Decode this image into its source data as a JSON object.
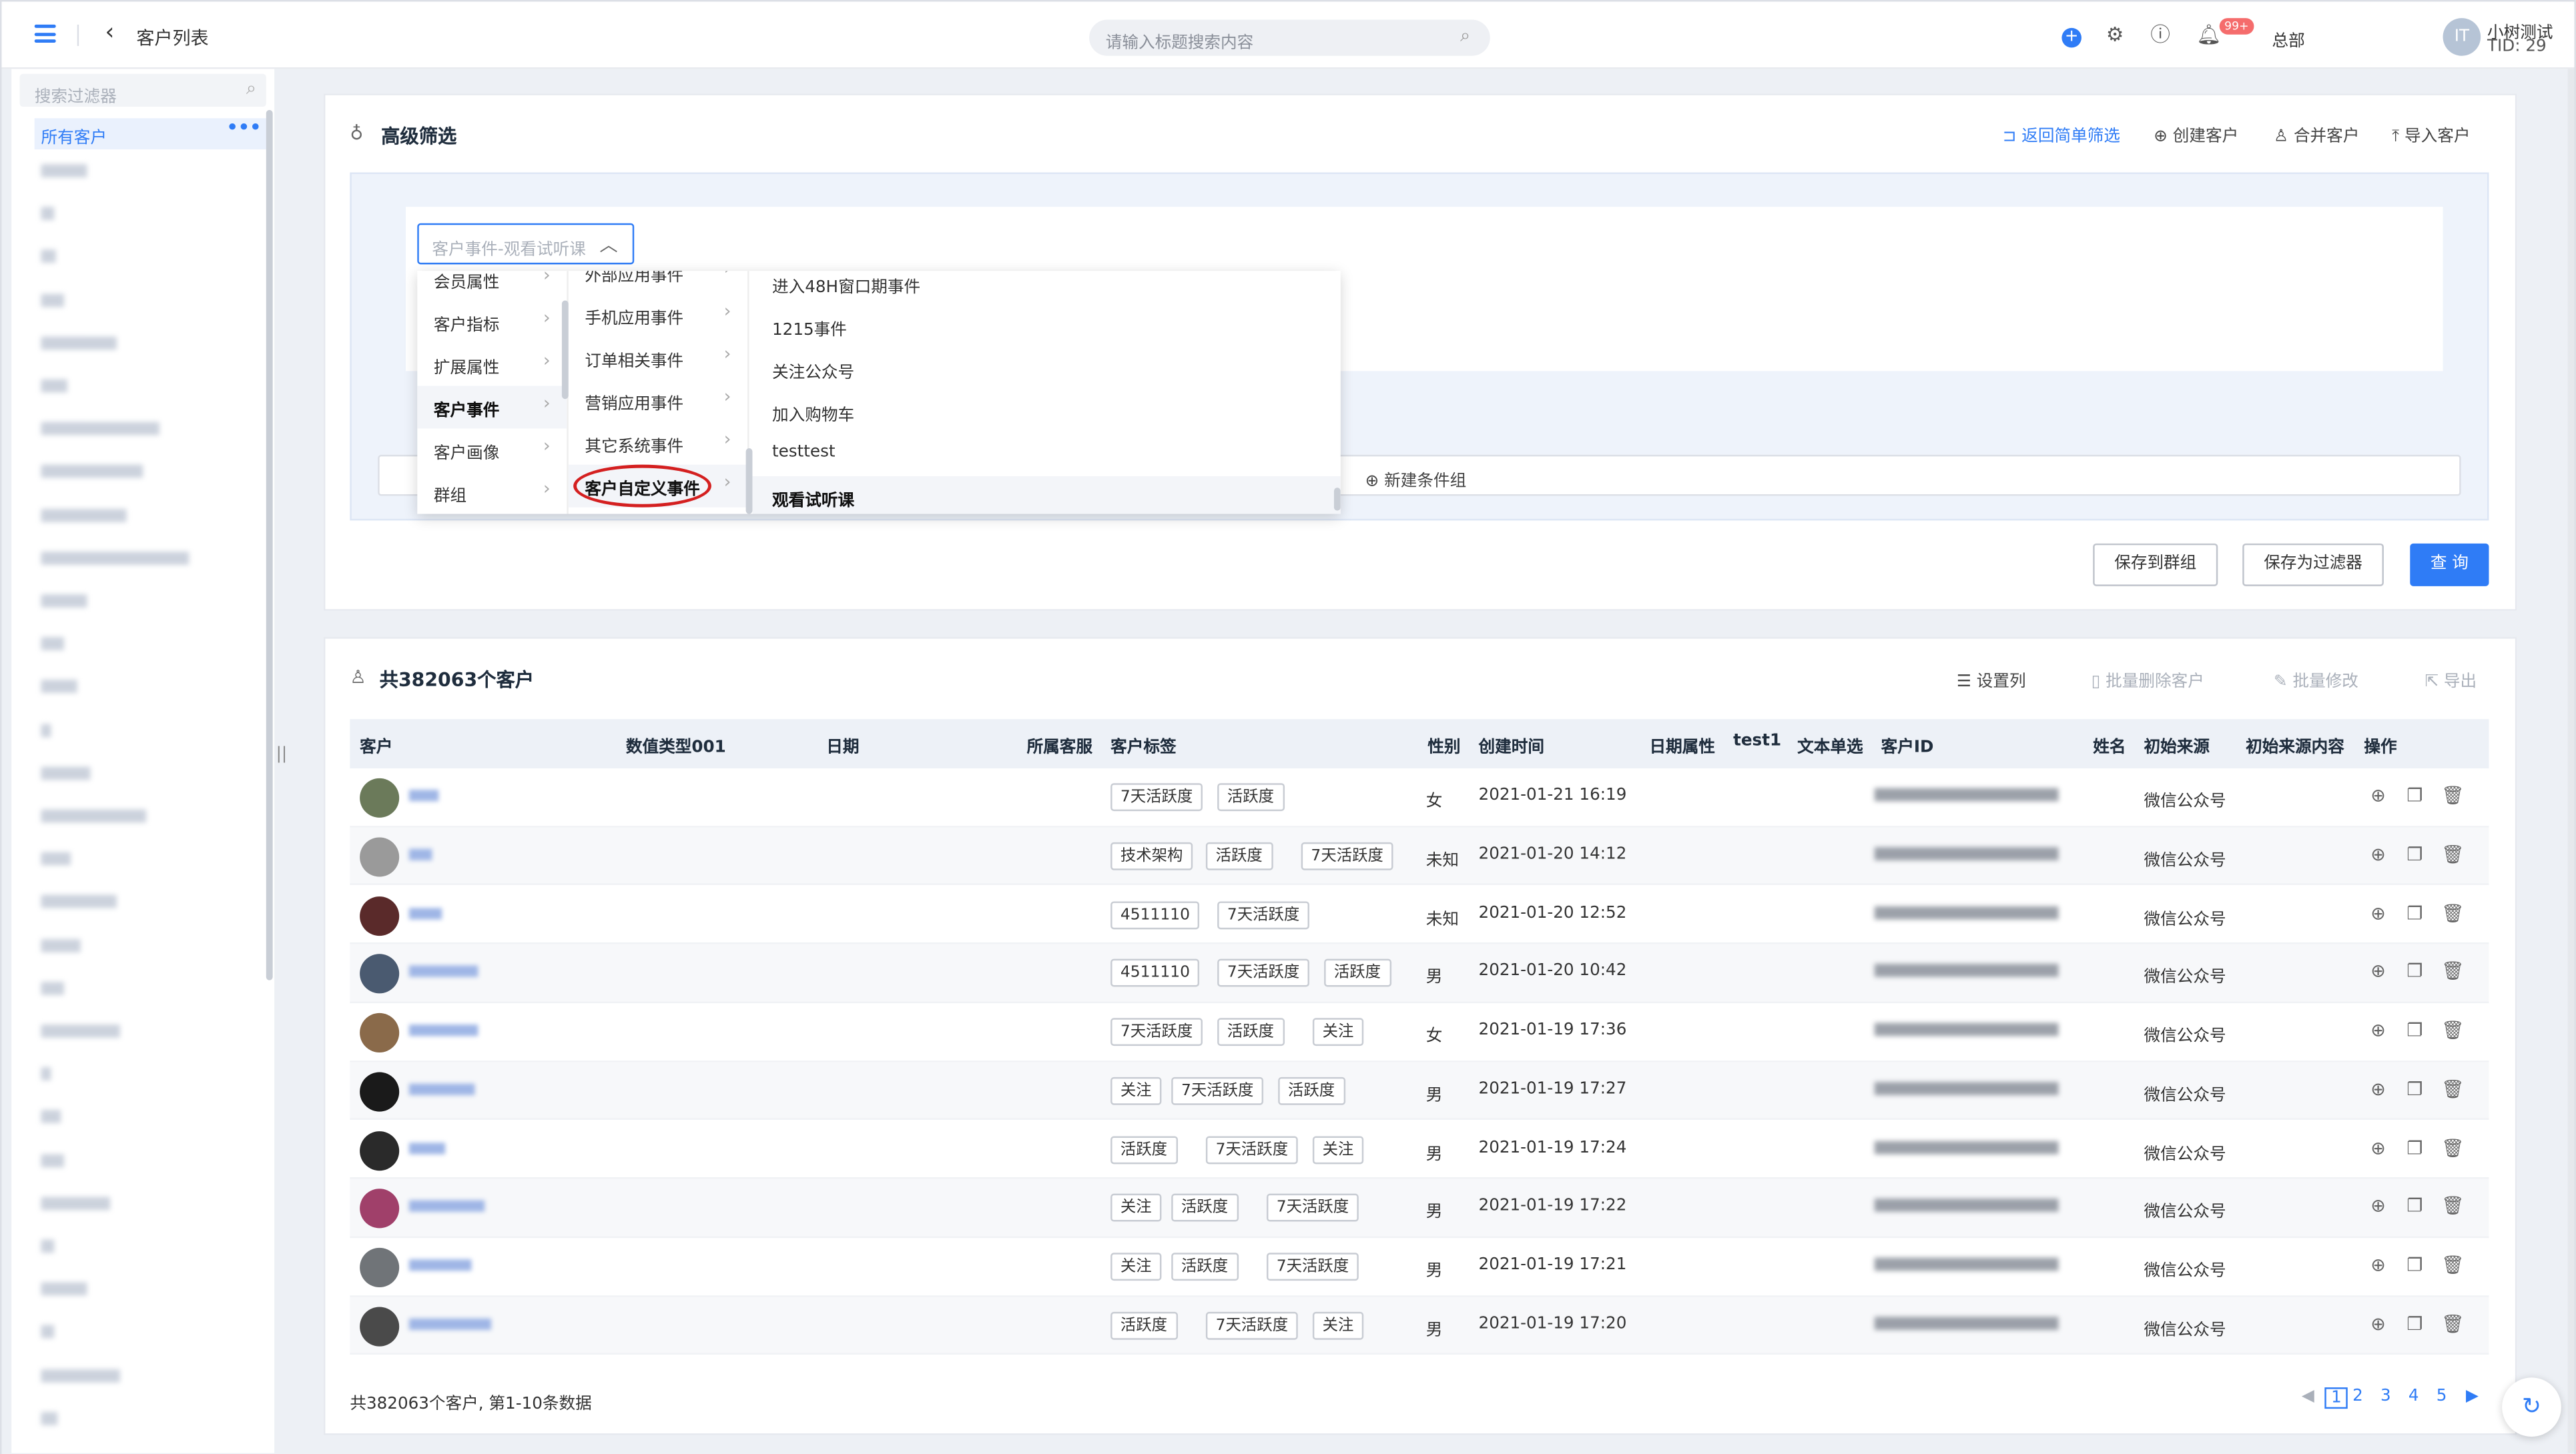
{
  "topbar": {
    "back_glyph": "‹",
    "title": "客户列表",
    "search_placeholder": "请输入标题搜索内容",
    "notification_badge": "99+",
    "org": "总部",
    "avatar_text": "IT",
    "user_name": "小树测试",
    "user_tid": "TID: 29"
  },
  "sidebar": {
    "search_placeholder": "搜索过滤器",
    "active_item": "所有客户",
    "more": "•••"
  },
  "filter": {
    "title": "高级筛选",
    "actions": {
      "back_simple": "返回简单筛选",
      "create": "创建客户",
      "merge": "合并客户",
      "import": "导入客户"
    },
    "condition_value": "客户事件-观看试听课",
    "new_group": "新建条件组",
    "cascader": {
      "level1": [
        "会员属性",
        "客户指标",
        "扩展属性",
        "客户事件",
        "客户画像",
        "群组"
      ],
      "level1_selected": "客户事件",
      "level2": [
        "外部应用事件",
        "手机应用事件",
        "订单相关事件",
        "营销应用事件",
        "其它系统事件",
        "客户自定义事件"
      ],
      "level2_selected": "客户自定义事件",
      "level3": [
        "进入48H窗口期事件",
        "1215事件",
        "关注公众号",
        "加入购物车",
        "testtest",
        "观看试听课"
      ],
      "level3_selected": "观看试听课"
    },
    "buttons": {
      "save_group": "保存到群组",
      "save_filter": "保存为过滤器",
      "query": "查 询"
    }
  },
  "list": {
    "title": "共382063个客户",
    "actions": {
      "columns": "设置列",
      "batch_delete": "批量删除客户",
      "batch_edit": "批量修改",
      "export": "导出"
    },
    "headers": [
      "客户",
      "数值类型001",
      "日期",
      "所属客服",
      "客户标签",
      "性别",
      "创建时间",
      "日期属性",
      "test1",
      "文本单选",
      "客户ID",
      "姓名",
      "初始来源",
      "初始来源内容",
      "操作"
    ],
    "rows": [
      {
        "tags": [
          "7天活跃度",
          "活跃度"
        ],
        "gender": "女",
        "created": "2021-01-21 16:19",
        "source": "微信公众号"
      },
      {
        "tags": [
          "技术架构",
          "活跃度",
          "7天活跃度"
        ],
        "gender": "未知",
        "created": "2021-01-20 14:12",
        "source": "微信公众号"
      },
      {
        "tags": [
          "4511110",
          "7天活跃度"
        ],
        "gender": "未知",
        "created": "2021-01-20 12:52",
        "source": "微信公众号"
      },
      {
        "tags": [
          "4511110",
          "7天活跃度",
          "活跃度"
        ],
        "gender": "男",
        "created": "2021-01-20 10:42",
        "source": "微信公众号"
      },
      {
        "tags": [
          "7天活跃度",
          "活跃度",
          "关注"
        ],
        "gender": "女",
        "created": "2021-01-19 17:36",
        "source": "微信公众号"
      },
      {
        "tags": [
          "关注",
          "7天活跃度",
          "活跃度"
        ],
        "gender": "男",
        "created": "2021-01-19 17:27",
        "source": "微信公众号"
      },
      {
        "tags": [
          "活跃度",
          "7天活跃度",
          "关注"
        ],
        "gender": "男",
        "created": "2021-01-19 17:24",
        "source": "微信公众号"
      },
      {
        "tags": [
          "关注",
          "活跃度",
          "7天活跃度"
        ],
        "gender": "男",
        "created": "2021-01-19 17:22",
        "source": "微信公众号"
      },
      {
        "tags": [
          "关注",
          "活跃度",
          "7天活跃度"
        ],
        "gender": "男",
        "created": "2021-01-19 17:21",
        "source": "微信公众号"
      },
      {
        "tags": [
          "活跃度",
          "7天活跃度",
          "关注"
        ],
        "gender": "男",
        "created": "2021-01-19 17:20",
        "source": "微信公众号"
      }
    ],
    "footer": "共382063个客户, 第1-10条数据",
    "pages": [
      "1",
      "2",
      "3",
      "4",
      "5"
    ],
    "current_page": "1"
  }
}
